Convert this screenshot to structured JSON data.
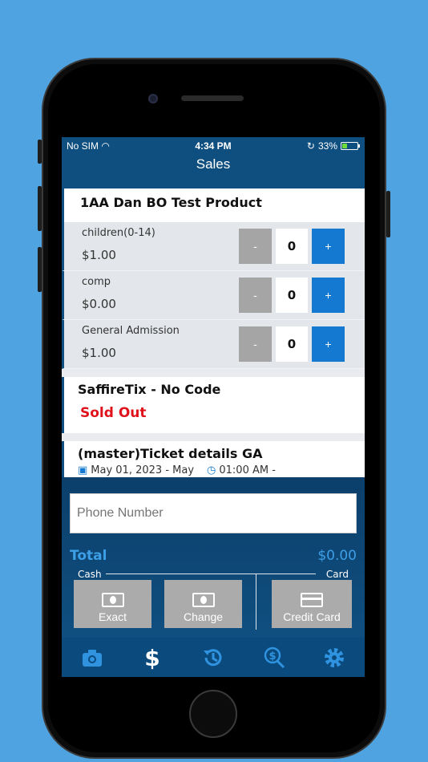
{
  "status": {
    "carrier": "No SIM",
    "time": "4:34 PM",
    "battery": "33%",
    "battery_level": 0.33
  },
  "header": {
    "title": "Sales"
  },
  "product": {
    "title": "1AA Dan BO Test Product",
    "rows": [
      {
        "name": "children(0-14)",
        "price": "$1.00",
        "qty": "0",
        "minus": "-",
        "plus": "+"
      },
      {
        "name": "comp",
        "price": "$0.00",
        "qty": "0",
        "minus": "-",
        "plus": "+"
      },
      {
        "name": "General Admission",
        "price": "$1.00",
        "qty": "0",
        "minus": "-",
        "plus": "+"
      }
    ]
  },
  "saffire": {
    "title": "SaffireTix - No Code",
    "status": "Sold Out"
  },
  "master": {
    "title": "(master)Ticket details GA",
    "date": "May 01, 2023 - May",
    "time": "01:00 AM -"
  },
  "panel": {
    "phone_placeholder": "Phone Number",
    "total_label": "Total",
    "total_value": "$0.00",
    "cash_label": "Cash",
    "card_label": "Card",
    "exact": "Exact",
    "change": "Change",
    "credit_card": "Credit Card"
  },
  "tabs": [
    "camera-icon",
    "dollar-icon",
    "history-icon",
    "search-dollar-icon",
    "gear-icon"
  ],
  "colors": {
    "accent": "#1479d1",
    "sold_out": "#e0121b",
    "header": "#0f4f80",
    "total": "#3d9fe6"
  }
}
